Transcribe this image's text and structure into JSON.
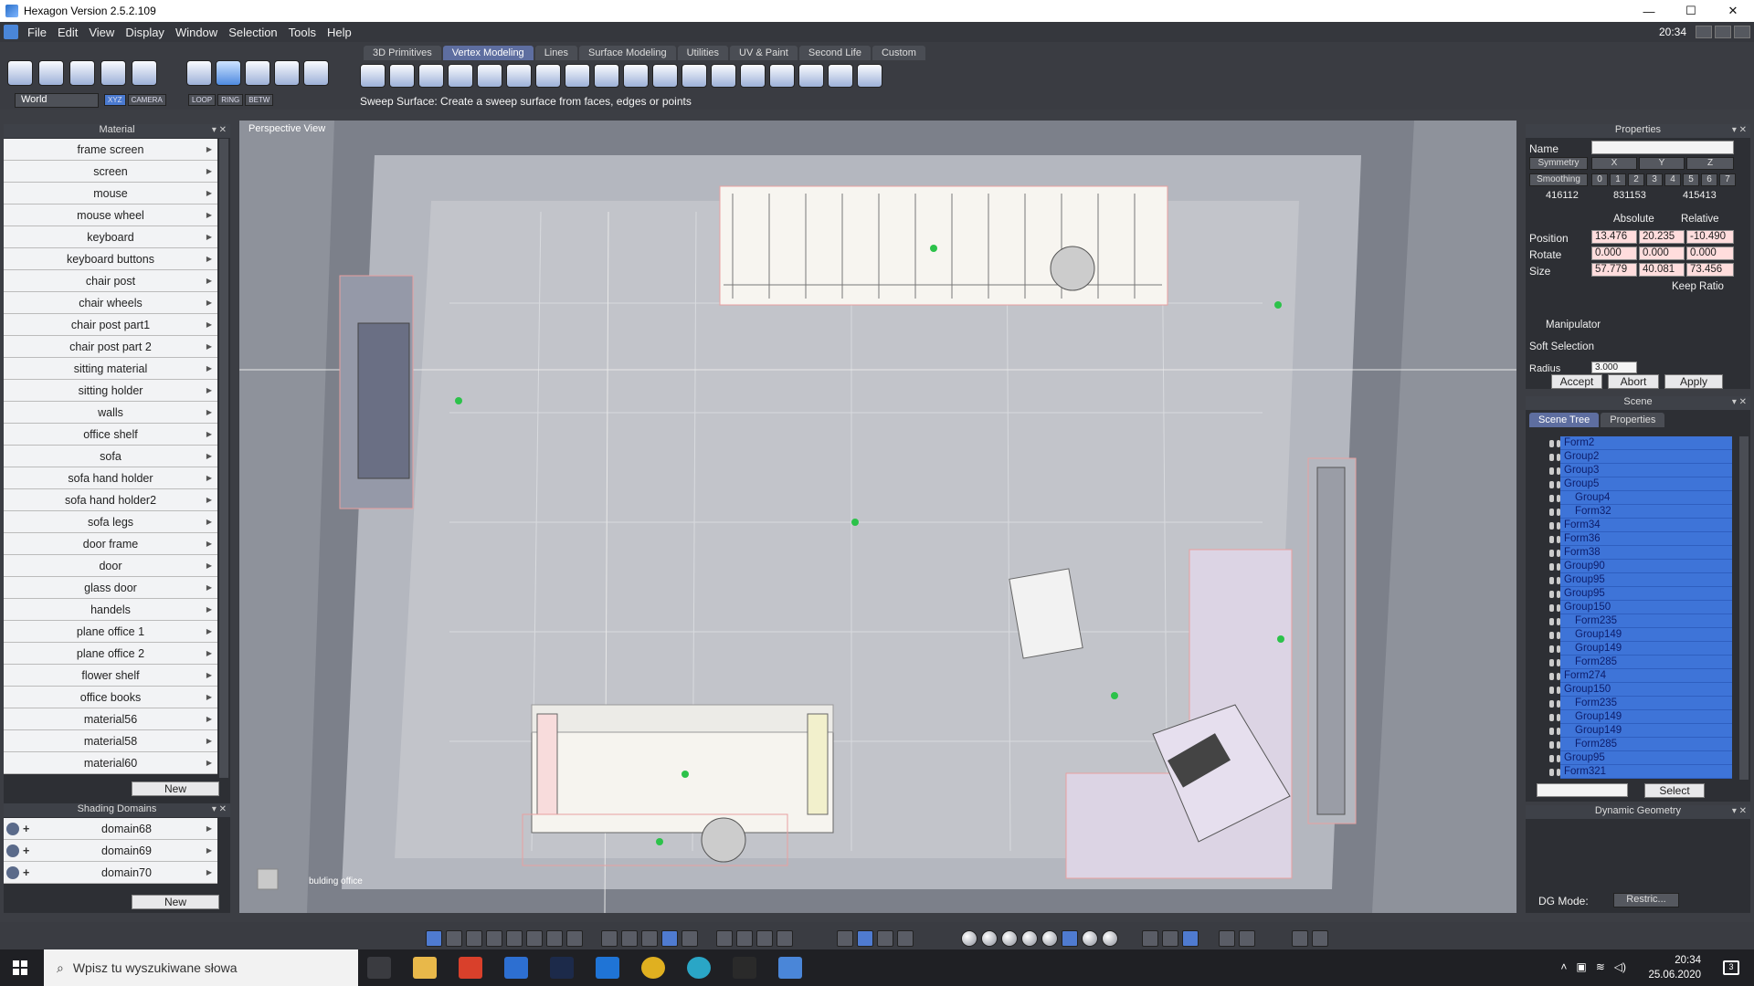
{
  "window": {
    "title": "Hexagon Version 2.5.2.109",
    "clock": "20:34"
  },
  "menu": [
    "File",
    "Edit",
    "View",
    "Display",
    "Window",
    "Selection",
    "Tools",
    "Help"
  ],
  "toolbar": {
    "tabs": [
      "3D Primitives",
      "Vertex Modeling",
      "Lines",
      "Surface Modeling",
      "Utilities",
      "UV & Paint",
      "Second Life",
      "Custom"
    ],
    "active_tab": "Vertex Modeling",
    "world_select": "World",
    "axis_buttons": [
      "XYZ",
      "CAMERA"
    ],
    "loop_buttons": [
      "LOOP",
      "RING",
      "BETW"
    ],
    "hint": "Sweep Surface: Create a sweep surface from faces, edges or points"
  },
  "material_panel": {
    "title": "Material",
    "items": [
      "frame screen",
      "screen",
      "mouse",
      "mouse wheel",
      "keyboard",
      "keyboard buttons",
      "chair post",
      "chair wheels",
      "chair post part1",
      "chair post part 2",
      "sitting material",
      "sitting holder",
      "walls",
      "office shelf",
      "sofa",
      "sofa hand holder",
      "sofa hand holder2",
      "sofa legs",
      "door frame",
      "door",
      "glass door",
      "handels",
      "plane office 1",
      "plane office 2",
      "flower shelf",
      "office books",
      "material56",
      "material58",
      "material60"
    ],
    "new_label": "New"
  },
  "shading_panel": {
    "title": "Shading Domains",
    "items": [
      "domain68",
      "domain69",
      "domain70"
    ],
    "new_label": "New"
  },
  "viewport": {
    "label": "Perspective View",
    "name": "bulding office"
  },
  "properties": {
    "title": "Properties",
    "name_label": "Name",
    "symmetry_label": "Symmetry",
    "symmetry_axes": [
      "X",
      "Y",
      "Z"
    ],
    "smoothing_label": "Smoothing",
    "smoothing_levels": [
      "0",
      "1",
      "2",
      "3",
      "4",
      "5",
      "6",
      "7"
    ],
    "counts": [
      "416112",
      "831153",
      "415413"
    ],
    "absolute_label": "Absolute",
    "relative_label": "Relative",
    "position_label": "Position",
    "position": [
      "13.476",
      "20.235",
      "-10.490"
    ],
    "rotate_label": "Rotate",
    "rotate": [
      "0.000",
      "0.000",
      "0.000"
    ],
    "size_label": "Size",
    "size": [
      "57.779",
      "40.081",
      "73.456"
    ],
    "keep_ratio_label": "Keep Ratio",
    "manipulator_label": "Manipulator",
    "soft_selection_label": "Soft Selection",
    "radius_label": "Radius",
    "radius_value": "3.000",
    "accept_label": "Accept",
    "abort_label": "Abort",
    "apply_label": "Apply"
  },
  "scene": {
    "title": "Scene",
    "tabs": [
      "Scene Tree",
      "Properties"
    ],
    "rows": [
      {
        "name": "Form2",
        "indent": 0
      },
      {
        "name": "Group2",
        "indent": 0
      },
      {
        "name": "Group3",
        "indent": 0
      },
      {
        "name": "Group5",
        "indent": 0
      },
      {
        "name": "Group4",
        "indent": 1
      },
      {
        "name": "Form32",
        "indent": 1
      },
      {
        "name": "Form34",
        "indent": 0
      },
      {
        "name": "Form36",
        "indent": 0
      },
      {
        "name": "Form38",
        "indent": 0
      },
      {
        "name": "Group90",
        "indent": 0
      },
      {
        "name": "Group95",
        "indent": 0
      },
      {
        "name": "Group95",
        "indent": 0
      },
      {
        "name": "Group150",
        "indent": 0
      },
      {
        "name": "Form235",
        "indent": 1
      },
      {
        "name": "Group149",
        "indent": 1
      },
      {
        "name": "Group149",
        "indent": 1
      },
      {
        "name": "Form285",
        "indent": 1
      },
      {
        "name": "Form274",
        "indent": 0
      },
      {
        "name": "Group150",
        "indent": 0
      },
      {
        "name": "Form235",
        "indent": 1
      },
      {
        "name": "Group149",
        "indent": 1
      },
      {
        "name": "Group149",
        "indent": 1
      },
      {
        "name": "Form285",
        "indent": 1
      },
      {
        "name": "Group95",
        "indent": 0
      },
      {
        "name": "Form321",
        "indent": 0
      }
    ],
    "select_label": "Select"
  },
  "dynamic_geometry": {
    "title": "Dynamic Geometry",
    "dg_mode_label": "DG Mode:",
    "dg_mode_value": "Restric..."
  },
  "taskbar": {
    "search_placeholder": "Wpisz tu wyszukiwane słowa",
    "time": "20:34",
    "date": "25.06.2020",
    "notif_count": "3"
  }
}
